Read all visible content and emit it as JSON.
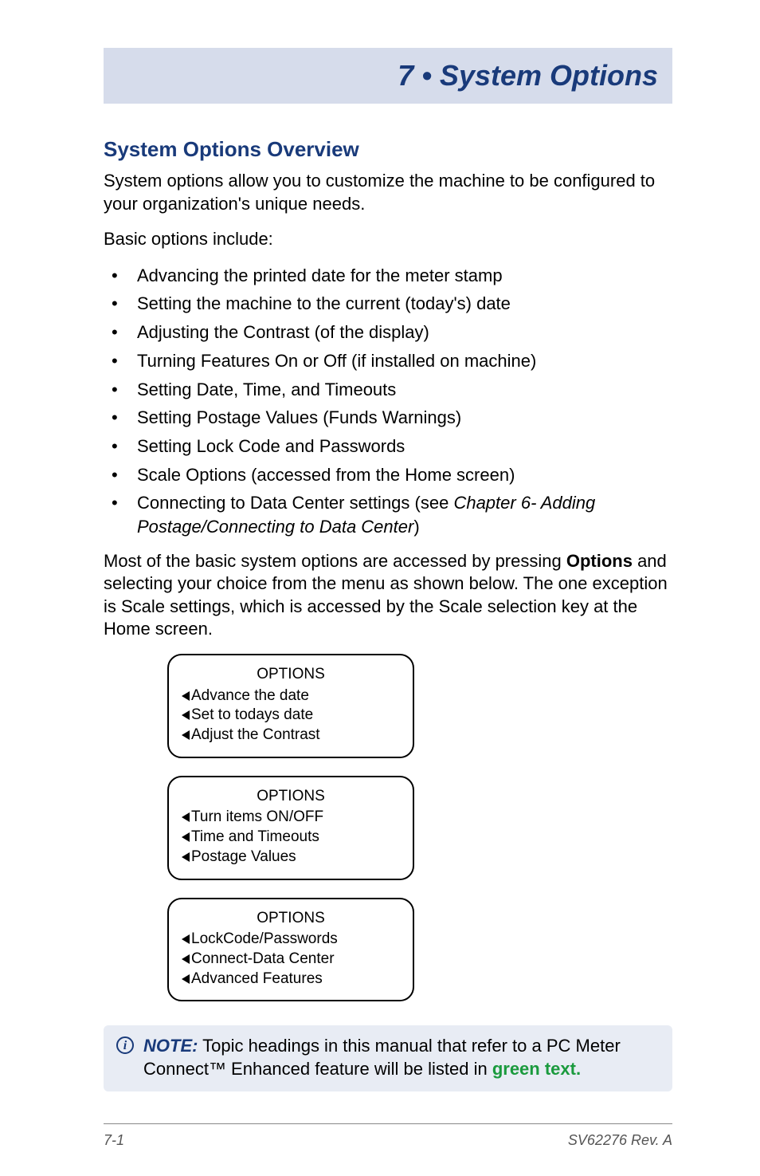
{
  "chapter": {
    "title": "7 • System Options"
  },
  "section": {
    "title": "System Options Overview",
    "intro": "System options allow you to customize the machine to be configured to your organization's unique needs.",
    "basic_label": "Basic options include:",
    "bullets": {
      "b0": "Advancing the printed date for the meter stamp",
      "b1": "Setting the machine to the current (today's) date",
      "b2": "Adjusting the Contrast (of the display)",
      "b3": "Turning Features On or Off (if installed on machine)",
      "b4": "Setting Date, Time, and Timeouts",
      "b5": "Setting Postage Values (Funds Warnings)",
      "b6": "Setting Lock Code and Passwords",
      "b7": "Scale Options (accessed from the Home screen)",
      "b8_pre": "Connecting to Data Center settings (see ",
      "b8_italic": "Chapter 6- Adding Postage/Connecting to Data Center",
      "b8_post": ")"
    },
    "after_bullets_pre": "Most of the basic system options are accessed by pressing ",
    "after_bullets_bold": "Options",
    "after_bullets_post": " and selecting your choice from the menu as shown below. The one exception is Scale settings, which is accessed by the Scale selection key at the Home screen."
  },
  "screens": [
    {
      "title": "OPTIONS",
      "lines": [
        "Advance the date",
        "Set to todays date",
        "Adjust the Contrast"
      ]
    },
    {
      "title": "OPTIONS",
      "lines": [
        "Turn items ON/OFF",
        "Time and Timeouts",
        "Postage Values"
      ]
    },
    {
      "title": "OPTIONS",
      "lines": [
        "LockCode/Passwords",
        "Connect-Data Center",
        "Advanced Features"
      ]
    }
  ],
  "note": {
    "icon_letter": "i",
    "label": "NOTE:",
    "text": " Topic headings in this manual that refer to a PC Meter Connect™ Enhanced feature will be listed in ",
    "green": "green text."
  },
  "footer": {
    "left": "7-1",
    "right": "SV62276 Rev. A"
  }
}
